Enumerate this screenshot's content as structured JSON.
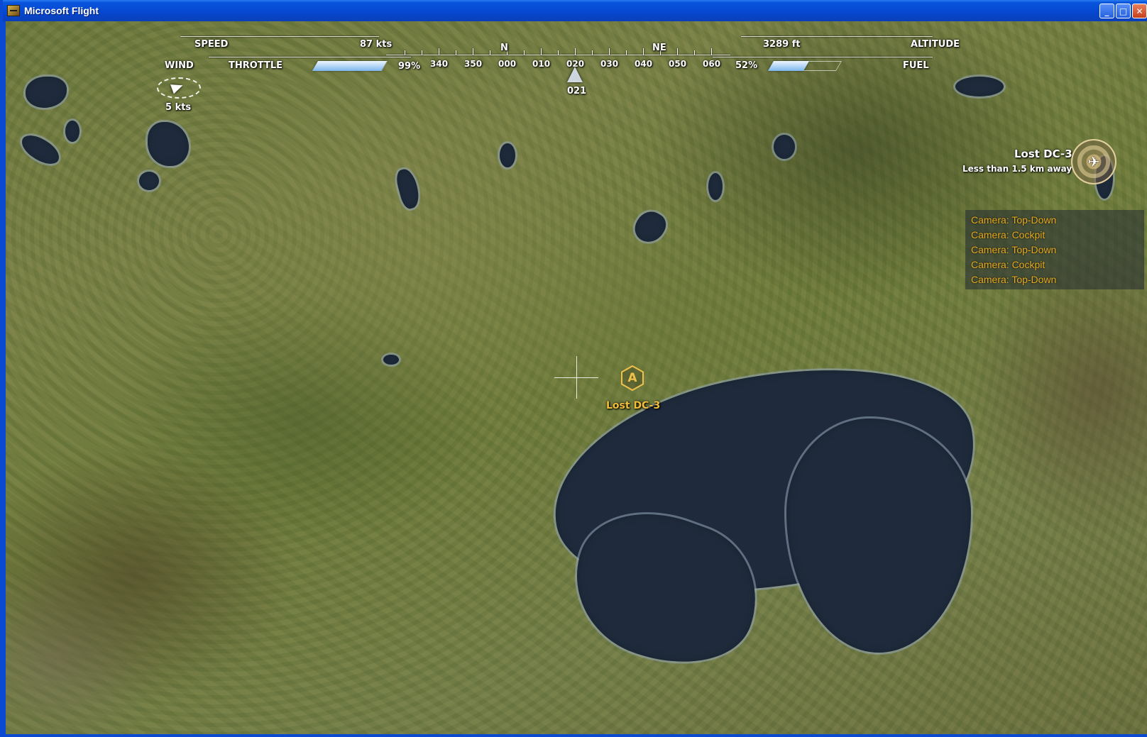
{
  "window": {
    "title": "Microsoft Flight",
    "buttons": {
      "minimize": "_",
      "maximize": "□",
      "close": "✕"
    }
  },
  "hud": {
    "speed_label": "SPEED",
    "speed_value": "87 kts",
    "throttle_label": "THROTTLE",
    "throttle_value": "99%",
    "throttle_fraction": 0.99,
    "wind_label": "WIND",
    "wind_value": "5  kts",
    "altitude_label": "ALTITUDE",
    "altitude_value": "3289 ft",
    "fuel_label": "FUEL",
    "fuel_value": "52%",
    "fuel_fraction": 0.52,
    "heading_value": "021",
    "compass_cardinals": [
      "N",
      "NE"
    ],
    "compass_ticks": [
      "340",
      "350",
      "000",
      "010",
      "020",
      "030",
      "040",
      "050",
      "060"
    ]
  },
  "objective": {
    "name": "Lost DC-3",
    "distance": "Less than 1.5 km away",
    "marker_label": "Lost DC-3",
    "marker_letter": "A"
  },
  "camera_log": [
    "Camera: Top-Down",
    "Camera: Cockpit",
    "Camera: Top-Down",
    "Camera: Cockpit",
    "Camera: Top-Down"
  ],
  "colors": {
    "title_bar": "#0a4ad2",
    "hud_text": "#ffffff",
    "accent_gold": "#f2bd3b",
    "water": "#1f2b3c"
  },
  "icons": {
    "app": "flight-app-icon",
    "wind": "wind-arrow-icon",
    "heading": "heading-arrow-icon",
    "target": "aircraft-target-icon",
    "waypoint": "hexagon-waypoint-icon"
  }
}
